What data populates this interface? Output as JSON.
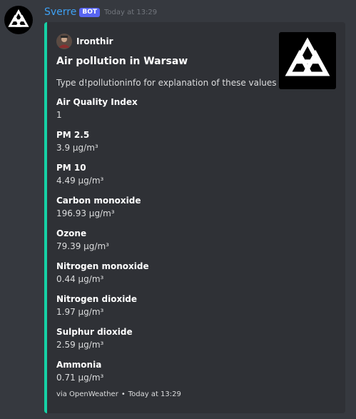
{
  "message": {
    "username": "Sverre",
    "bot_tag": "BOT",
    "timestamp": "Today at 13:29"
  },
  "embed": {
    "accent_color": "#16d1a5",
    "author": "Ironthir",
    "title": "Air pollution in Warsaw",
    "description": "Type d!pollutioninfo for explanation of these values",
    "fields": [
      {
        "name": "Air Quality Index",
        "value": "1"
      },
      {
        "name": "PM 2.5",
        "value": "3.9 µg/m³"
      },
      {
        "name": "PM 10",
        "value": "4.49 µg/m³"
      },
      {
        "name": "Carbon monoxide",
        "value": "196.93 µg/m³"
      },
      {
        "name": "Ozone",
        "value": "79.39 µg/m³"
      },
      {
        "name": "Nitrogen monoxide",
        "value": "0.44 µg/m³"
      },
      {
        "name": "Nitrogen dioxide",
        "value": "1.97 µg/m³"
      },
      {
        "name": "Sulphur dioxide",
        "value": "2.59 µg/m³"
      },
      {
        "name": "Ammonia",
        "value": "0.71 µg/m³"
      }
    ],
    "footer": {
      "source": "via OpenWeather",
      "separator": "•",
      "timestamp": "Today at 13:29"
    }
  },
  "icons": {
    "avatar": "valknut-logo-icon",
    "author_icon": "user-avatar-icon",
    "thumbnail": "valknut-logo-icon"
  }
}
